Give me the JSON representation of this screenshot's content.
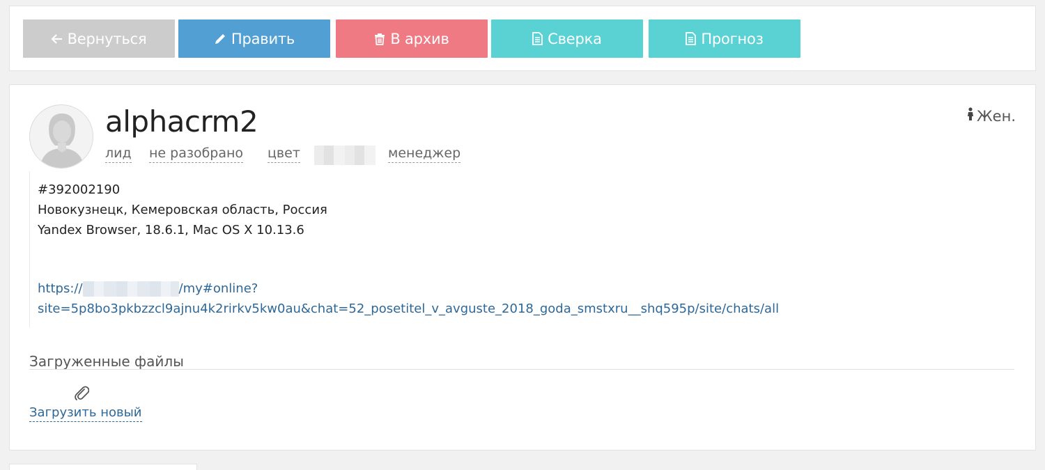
{
  "toolbar": {
    "back_label": "Вернуться",
    "edit_label": "Править",
    "archive_label": "В архив",
    "sverka_label": "Сверка",
    "prognoz_label": "Прогноз",
    "colors": {
      "back": "#cccccc",
      "edit": "#529fd4",
      "archive": "#ef7a84",
      "sverka": "#5ad1d3",
      "prognoz": "#5ad1d3"
    }
  },
  "contact": {
    "name": "alphacrm2",
    "gender": "Жен.",
    "tags": {
      "type": "лид",
      "status": "не разобрано",
      "color": "цвет",
      "manager": "менеджер"
    },
    "id": "#392002190",
    "location": "Новокузнецк, Кемеровская область, Россия",
    "browser": "Yandex Browser, 18.6.1, Mac OS X 10.13.6",
    "link_prefix": "https://",
    "link_rest": "/my#online?site=5p8bo3pkbzzcl9ajnu4k2rirkv5kw0au&chat=52_posetitel_v_avguste_2018_goda_smstxru__shq595p/site/chats/all"
  },
  "files": {
    "title": "Загруженные файлы",
    "upload_label": "Загрузить новый"
  },
  "icons": [
    "arrow-left-icon",
    "pencil-icon",
    "trash-icon",
    "document-icon",
    "female-icon",
    "paperclip-icon",
    "avatar-female-icon"
  ]
}
